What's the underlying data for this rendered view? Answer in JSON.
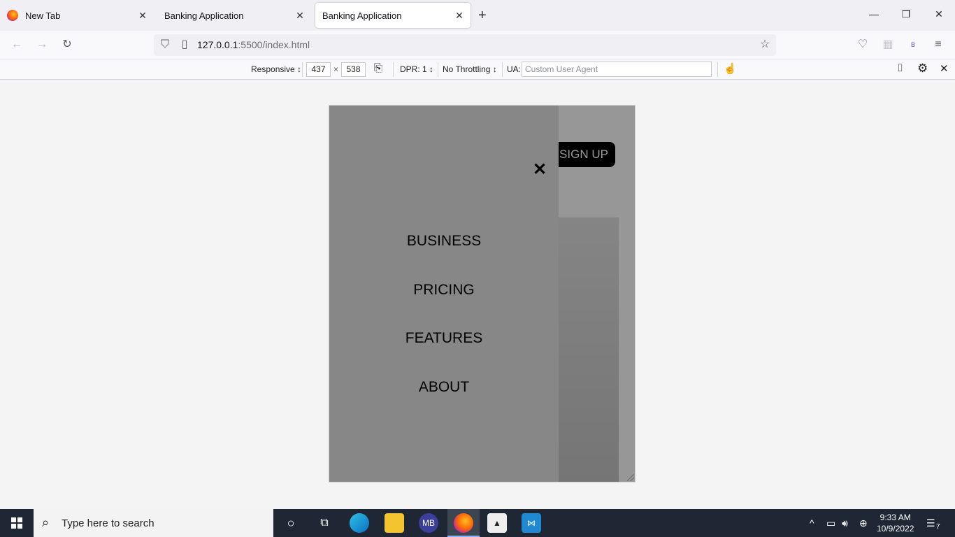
{
  "browser": {
    "tabs": [
      {
        "label": "New Tab"
      },
      {
        "label": "Banking Application"
      },
      {
        "label": "Banking Application"
      }
    ],
    "url_host": "127.0.0.1",
    "url_rest": ":5500/index.html"
  },
  "rdm": {
    "device": "Responsive ↕",
    "width": "437",
    "times": "×",
    "height": "538",
    "dpr": "DPR: 1 ↕",
    "throttling": "No Throttling ↕",
    "ua_label": "UA:",
    "ua_placeholder": "Custom User Agent"
  },
  "page": {
    "signup_label": "SIGN UP",
    "close_glyph": "✕",
    "menu": [
      "BUSINESS",
      "PRICING",
      "FEATURES",
      "ABOUT"
    ]
  },
  "taskbar": {
    "search_placeholder": "Type here to search",
    "time": "9:33 AM",
    "date": "10/9/2022",
    "notification_count": "7",
    "mb_label": "MB"
  }
}
